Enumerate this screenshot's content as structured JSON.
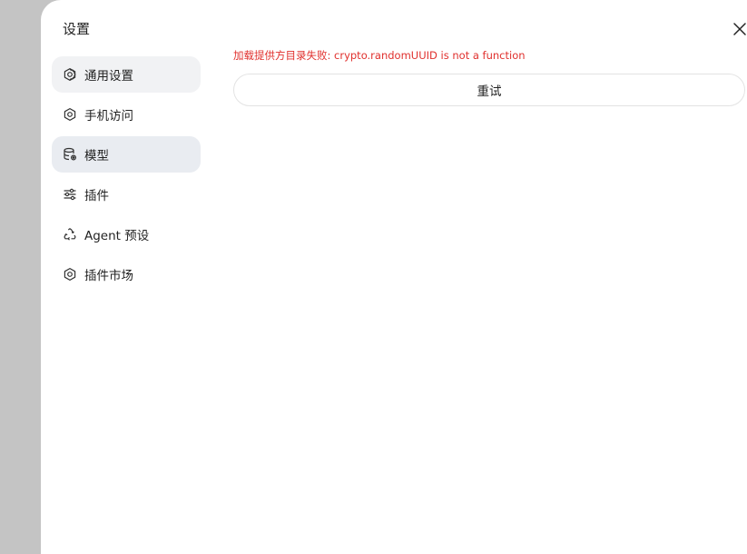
{
  "dialog": {
    "title": "设置",
    "close_icon": "close-icon"
  },
  "sidebar": {
    "items": [
      {
        "label": "通用设置",
        "icon": "gear-icon",
        "state": "hover"
      },
      {
        "label": "手机访问",
        "icon": "gear-icon",
        "state": "normal"
      },
      {
        "label": "模型",
        "icon": "database-gear-icon",
        "state": "selected"
      },
      {
        "label": "插件",
        "icon": "sliders-icon",
        "state": "normal"
      },
      {
        "label": "Agent 预设",
        "icon": "recycle-icon",
        "state": "normal"
      },
      {
        "label": "插件市场",
        "icon": "gear-icon",
        "state": "normal"
      }
    ]
  },
  "main": {
    "error_message": "加载提供方目录失败: crypto.randomUUID is not a function",
    "retry_label": "重试"
  },
  "colors": {
    "error": "#e0302d",
    "backdrop": "#c4c4c4",
    "nav_hover_bg": "#f1f2f4",
    "nav_selected_bg": "#e9ecf1"
  }
}
